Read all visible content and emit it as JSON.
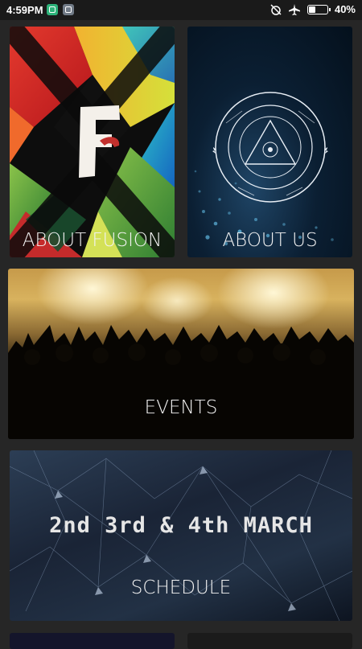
{
  "status_bar": {
    "time": "4:59PM",
    "battery_text": "40%",
    "battery_level": 0.4
  },
  "cards": {
    "about_fusion": {
      "label": "ABOUT FUSION"
    },
    "about_us": {
      "label": "ABOUT US"
    },
    "events": {
      "label": "EVENTS"
    },
    "schedule": {
      "label": "SCHEDULE",
      "dates": "2nd 3rd & 4th MARCH"
    }
  },
  "colors": {
    "background": "#262626",
    "status_bar": "#1a1a1a",
    "label_text": "#f2f2f2"
  }
}
